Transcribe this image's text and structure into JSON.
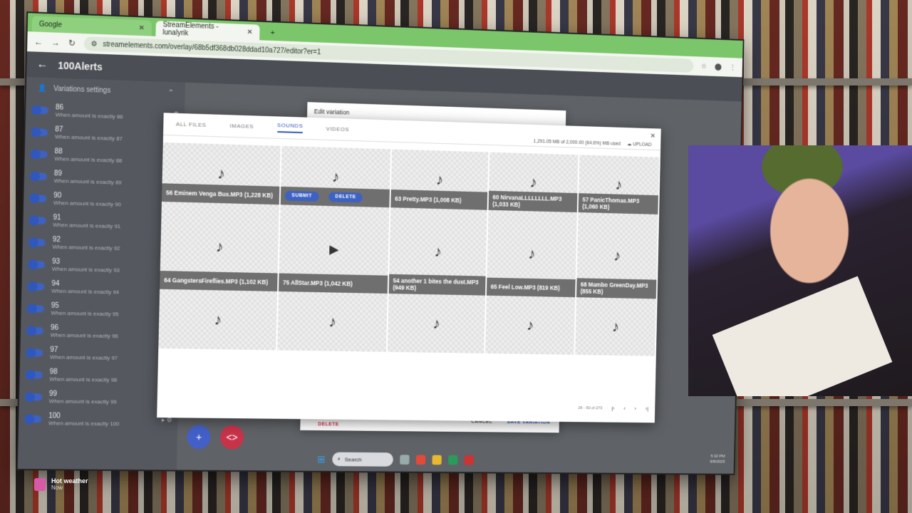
{
  "browser": {
    "tabs": [
      {
        "title": "Google"
      },
      {
        "title": "StreamElements - lunalyrik"
      }
    ],
    "url": "streamelements.com/overlay/68b5df368db028ddad10a727/editor?er=1"
  },
  "app": {
    "title": "100Alerts",
    "sidebar_header": "Variations settings",
    "variations": [
      {
        "num": "86",
        "sub": "When amount is exactly 86"
      },
      {
        "num": "87",
        "sub": "When amount is exactly 87"
      },
      {
        "num": "88",
        "sub": "When amount is exactly 88"
      },
      {
        "num": "89",
        "sub": "When amount is exactly 89"
      },
      {
        "num": "90",
        "sub": "When amount is exactly 90"
      },
      {
        "num": "91",
        "sub": "When amount is exactly 91"
      },
      {
        "num": "92",
        "sub": "When amount is exactly 92"
      },
      {
        "num": "93",
        "sub": "When amount is exactly 93"
      },
      {
        "num": "94",
        "sub": "When amount is exactly 94"
      },
      {
        "num": "95",
        "sub": "When amount is exactly 95"
      },
      {
        "num": "96",
        "sub": "When amount is exactly 96"
      },
      {
        "num": "97",
        "sub": "When amount is exactly 97"
      },
      {
        "num": "98",
        "sub": "When amount is exactly 98"
      },
      {
        "num": "99",
        "sub": "When amount is exactly 99"
      },
      {
        "num": "100",
        "sub": "When amount is exactly 100"
      }
    ]
  },
  "edit_dialog": {
    "title": "Edit variation",
    "cancel": "CANCEL",
    "save": "SAVE VARIATION",
    "delete": "DELETE"
  },
  "picker": {
    "tabs": [
      "ALL FILES",
      "IMAGES",
      "SOUNDS",
      "VIDEOS"
    ],
    "active_tab": "SOUNDS",
    "usage": "1,291.05 MB of 2,000.00 (64.6%) MB used",
    "upload": "UPLOAD",
    "submit": "SUBMIT",
    "delete": "DELETE",
    "files_row1": [
      "56 Eminem Venga Bus.MP3 (1,228 KB)",
      "",
      "63 Pretty.MP3 (1,008 KB)",
      "60 NirvanaLLLLLLLL.MP3 (1,033 KB)",
      "57 PanicThomas.MP3 (1,060 KB)"
    ],
    "files_row2": [
      "64 GangstersFireflies.MP3 (1,102 KB)",
      "75 AllStar.MP3 (1,042 KB)",
      "54 another 1 bites the dust.MP3 (949 KB)",
      "65 Feel Low.MP3 (819 KB)",
      "68 Mambo GreenDay.MP3 (855 KB)"
    ],
    "pagination": "26 - 50 of 273"
  },
  "taskbar": {
    "search": "Search",
    "time": "5:32 PM",
    "date": "9/8/2025"
  },
  "notification": {
    "title": "Hot weather",
    "time": "Now"
  },
  "colors": {
    "chrome_green": "#7bc56a",
    "accent_blue": "#2f57bd",
    "delete_red": "#e0334a",
    "caption_gray": "#6f6f6f"
  }
}
